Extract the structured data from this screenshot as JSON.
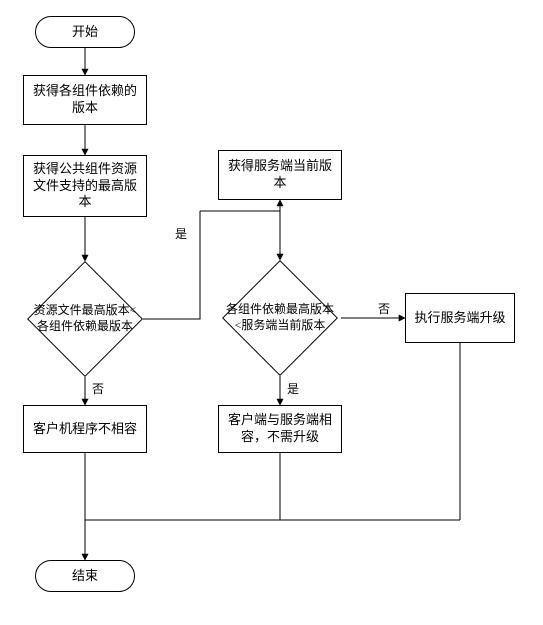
{
  "flowchart": {
    "start": "开始",
    "end": "结束",
    "p1": "获得各组件依赖的\n版本",
    "p2": "获得公共组件资源\n文件支持的最高版\n本",
    "d1": "资源文件最高版本<\n各组件依赖最版本",
    "p3": "客户机程序不相容",
    "p4": "获得服务端当前版\n本",
    "d2": "各组件依赖最高版本\n<服务端当前版本",
    "p5": "客户端与服务端相\n容，不需升级",
    "p6": "执行服务端升级"
  },
  "labels": {
    "yes": "是",
    "no": "否"
  },
  "chart_data": {
    "type": "flowchart",
    "nodes": [
      {
        "id": "start",
        "type": "terminator",
        "text": "开始"
      },
      {
        "id": "p1",
        "type": "process",
        "text": "获得各组件依赖的版本"
      },
      {
        "id": "p2",
        "type": "process",
        "text": "获得公共组件资源文件支持的最高版本"
      },
      {
        "id": "d1",
        "type": "decision",
        "text": "资源文件最高版本<各组件依赖最版本"
      },
      {
        "id": "p3",
        "type": "process",
        "text": "客户机程序不相容"
      },
      {
        "id": "p4",
        "type": "process",
        "text": "获得服务端当前版本"
      },
      {
        "id": "d2",
        "type": "decision",
        "text": "各组件依赖最高版本<服务端当前版本"
      },
      {
        "id": "p5",
        "type": "process",
        "text": "客户端与服务端相容，不需升级"
      },
      {
        "id": "p6",
        "type": "process",
        "text": "执行服务端升级"
      },
      {
        "id": "end",
        "type": "terminator",
        "text": "结束"
      }
    ],
    "edges": [
      {
        "from": "start",
        "to": "p1"
      },
      {
        "from": "p1",
        "to": "p2"
      },
      {
        "from": "p2",
        "to": "d1"
      },
      {
        "from": "d1",
        "to": "p4",
        "label": "是"
      },
      {
        "from": "d1",
        "to": "p3",
        "label": "否"
      },
      {
        "from": "p4",
        "to": "d2"
      },
      {
        "from": "d2",
        "to": "p5",
        "label": "是"
      },
      {
        "from": "d2",
        "to": "p6",
        "label": "否"
      },
      {
        "from": "p3",
        "to": "end"
      },
      {
        "from": "p5",
        "to": "end"
      },
      {
        "from": "p6",
        "to": "end"
      }
    ]
  }
}
